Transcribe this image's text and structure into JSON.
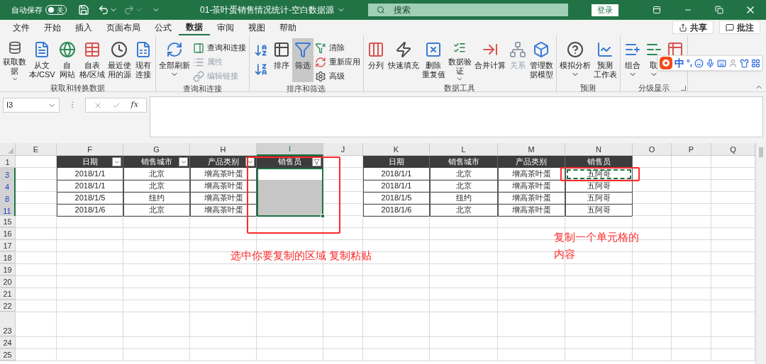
{
  "title_bar": {
    "autosave_label": "自动保存",
    "autosave_toggle": {
      "label": "关",
      "on": false
    },
    "redo_disabled": true,
    "document_title": "01-茶叶蛋销售情况统计-空白数据源",
    "search_placeholder": "搜索",
    "login_button": "登录"
  },
  "ribbon_tabs": [
    {
      "label": "文件",
      "selected": false
    },
    {
      "label": "开始",
      "selected": false
    },
    {
      "label": "插入",
      "selected": false
    },
    {
      "label": "页面布局",
      "selected": false
    },
    {
      "label": "公式",
      "selected": false
    },
    {
      "label": "数据",
      "selected": true
    },
    {
      "label": "审阅",
      "selected": false
    },
    {
      "label": "视图",
      "selected": false
    },
    {
      "label": "帮助",
      "selected": false
    }
  ],
  "share_button": "共享",
  "comment_button": "批注",
  "ribbon_groups": [
    {
      "label": "获取和转换数据",
      "buttons": [
        {
          "kind": "large",
          "lines": [
            "获取数",
            "据"
          ],
          "dropdown": true,
          "disabled": false,
          "pressed": false
        },
        {
          "kind": "large",
          "lines": [
            "从文",
            "本/CSV"
          ],
          "dropdown": false,
          "disabled": false,
          "pressed": false
        },
        {
          "kind": "large",
          "lines": [
            "自",
            "网站"
          ],
          "dropdown": false,
          "disabled": false,
          "pressed": false
        },
        {
          "kind": "large",
          "lines": [
            "自表",
            "格/区域"
          ],
          "dropdown": false,
          "disabled": false,
          "pressed": false
        },
        {
          "kind": "large",
          "lines": [
            "最近使",
            "用的源"
          ],
          "dropdown": false,
          "disabled": false,
          "pressed": false
        },
        {
          "kind": "large",
          "lines": [
            "现有",
            "连接"
          ],
          "dropdown": false,
          "disabled": false,
          "pressed": false
        }
      ]
    },
    {
      "label": "查询和连接",
      "buttons": [
        {
          "kind": "large",
          "lines": [
            "全部刷新"
          ],
          "dropdown": true,
          "disabled": false,
          "pressed": false
        },
        {
          "kind": "small",
          "label": "查询和连接",
          "disabled": false
        },
        {
          "kind": "small",
          "label": "属性",
          "disabled": true
        },
        {
          "kind": "small",
          "label": "编辑链接",
          "disabled": true
        }
      ]
    },
    {
      "label": "排序和筛选",
      "buttons": [
        {
          "kind": "icon",
          "disabled": false
        },
        {
          "kind": "icon",
          "disabled": false
        },
        {
          "kind": "large",
          "lines": [
            "排序"
          ],
          "dropdown": false,
          "disabled": false,
          "pressed": false
        },
        {
          "kind": "large",
          "lines": [
            "筛选"
          ],
          "dropdown": false,
          "disabled": false,
          "pressed": true
        },
        {
          "kind": "small",
          "label": "清除",
          "disabled": false
        },
        {
          "kind": "small",
          "label": "重新应用",
          "disabled": false
        },
        {
          "kind": "small",
          "label": "高级",
          "disabled": false
        }
      ]
    },
    {
      "label": "数据工具",
      "buttons": [
        {
          "kind": "large",
          "lines": [
            "分列"
          ],
          "dropdown": false,
          "disabled": false,
          "pressed": false
        },
        {
          "kind": "large",
          "lines": [
            "快速填充"
          ],
          "dropdown": false,
          "disabled": false,
          "pressed": false
        },
        {
          "kind": "large",
          "lines": [
            "删除",
            "重复值"
          ],
          "dropdown": false,
          "disabled": false,
          "pressed": false
        },
        {
          "kind": "large",
          "lines": [
            "数据验",
            "证"
          ],
          "dropdown": true,
          "disabled": false,
          "pressed": false
        },
        {
          "kind": "large",
          "lines": [
            "合并计算"
          ],
          "dropdown": false,
          "disabled": false,
          "pressed": false
        },
        {
          "kind": "large",
          "lines": [
            "关系"
          ],
          "dropdown": false,
          "disabled": true,
          "pressed": false
        },
        {
          "kind": "large",
          "lines": [
            "管理数",
            "据模型"
          ],
          "dropdown": false,
          "disabled": false,
          "pressed": false
        }
      ]
    },
    {
      "label": "预测",
      "buttons": [
        {
          "kind": "large",
          "lines": [
            "模拟分析"
          ],
          "dropdown": true,
          "disabled": false,
          "pressed": false
        },
        {
          "kind": "large",
          "lines": [
            "预测",
            "工作表"
          ],
          "dropdown": false,
          "disabled": false,
          "pressed": false
        }
      ]
    },
    {
      "label": "分级显示",
      "buttons": [
        {
          "kind": "large",
          "lines": [
            "组合"
          ],
          "dropdown": true,
          "disabled": false,
          "pressed": false
        },
        {
          "kind": "large",
          "lines": [
            "取"
          ],
          "dropdown": true,
          "disabled": false,
          "pressed": false
        },
        {
          "kind": "large"
        }
      ]
    }
  ],
  "ime_toolbar": {
    "mode": "中",
    "punctuation": "°,"
  },
  "formula_bar": {
    "name_box": "I3",
    "function_label": "fx"
  },
  "sheet": {
    "columns": [
      {
        "label": "E",
        "selected": false
      },
      {
        "label": "F",
        "selected": false
      },
      {
        "label": "G",
        "selected": false
      },
      {
        "label": "H",
        "selected": false
      },
      {
        "label": "I",
        "selected": true
      },
      {
        "label": "J",
        "selected": false
      },
      {
        "label": "K",
        "selected": false
      },
      {
        "label": "L",
        "selected": false
      },
      {
        "label": "M",
        "selected": false
      },
      {
        "label": "N",
        "selected": false
      },
      {
        "label": "O",
        "selected": false
      },
      {
        "label": "P",
        "selected": false
      },
      {
        "label": "Q",
        "selected": false
      }
    ],
    "rows": [
      {
        "label": "1",
        "filtered": false,
        "selected": false,
        "kind": "normal"
      },
      {
        "label": "3",
        "filtered": true,
        "selected": true,
        "kind": "normal"
      },
      {
        "label": "4",
        "filtered": true,
        "selected": true,
        "kind": "normal"
      },
      {
        "label": "8",
        "filtered": true,
        "selected": true,
        "kind": "normal"
      },
      {
        "label": "11",
        "filtered": true,
        "selected": true,
        "kind": "normal"
      },
      {
        "label": "15",
        "filtered": false,
        "selected": false,
        "kind": "normal"
      },
      {
        "label": "16",
        "filtered": false,
        "selected": false,
        "kind": "normal"
      },
      {
        "label": "17",
        "filtered": false,
        "selected": false,
        "kind": "normal"
      },
      {
        "label": "18",
        "filtered": false,
        "selected": false,
        "kind": "normal"
      },
      {
        "label": "19",
        "filtered": false,
        "selected": false,
        "kind": "normal"
      },
      {
        "label": "20",
        "filtered": false,
        "selected": false,
        "kind": "normal"
      },
      {
        "label": "21",
        "filtered": false,
        "selected": false,
        "kind": "normal"
      },
      {
        "label": "22",
        "filtered": false,
        "selected": false,
        "kind": "normal"
      },
      {
        "label": "23",
        "filtered": false,
        "selected": false,
        "kind": "tall"
      },
      {
        "label": "24",
        "filtered": false,
        "selected": false,
        "kind": "normal"
      },
      {
        "label": "25",
        "filtered": false,
        "selected": false,
        "kind": "normal"
      }
    ]
  },
  "left_table": {
    "columns": [
      {
        "label": "日期",
        "kind": "dropdown"
      },
      {
        "label": "销售城市",
        "kind": "dropdown"
      },
      {
        "label": "产品类别",
        "kind": "dropdown"
      },
      {
        "label": "销售员",
        "kind": "filtered"
      }
    ],
    "rows": [
      {
        "cells": [
          "2018/1/1",
          "北京",
          "增高茶叶蛋"
        ],
        "active": true
      },
      {
        "cells": [
          "2018/1/1",
          "北京",
          "增高茶叶蛋"
        ],
        "active": false
      },
      {
        "cells": [
          "2018/1/5",
          "纽约",
          "增高茶叶蛋"
        ],
        "active": false
      },
      {
        "cells": [
          "2018/1/6",
          "北京",
          "增高茶叶蛋"
        ],
        "active": false
      }
    ]
  },
  "right_table": {
    "columns": [
      "日期",
      "销售城市",
      "产品类别",
      "销售员"
    ],
    "rows": [
      {
        "cells": [
          "2018/1/1",
          "北京",
          "增高茶叶蛋",
          "五阿哥"
        ],
        "copied": true
      },
      {
        "cells": [
          "2018/1/1",
          "北京",
          "增高茶叶蛋",
          "五阿哥"
        ],
        "copied": false
      },
      {
        "cells": [
          "2018/1/5",
          "纽约",
          "增高茶叶蛋",
          "五阿哥"
        ],
        "copied": false
      },
      {
        "cells": [
          "2018/1/6",
          "北京",
          "增高茶叶蛋",
          "五阿哥"
        ],
        "copied": false
      }
    ]
  },
  "annotations": [
    {
      "text": "选中你要复制的区域 复制粘贴"
    },
    {
      "text": "复制一个单元格的"
    },
    {
      "text": "内容"
    }
  ]
}
